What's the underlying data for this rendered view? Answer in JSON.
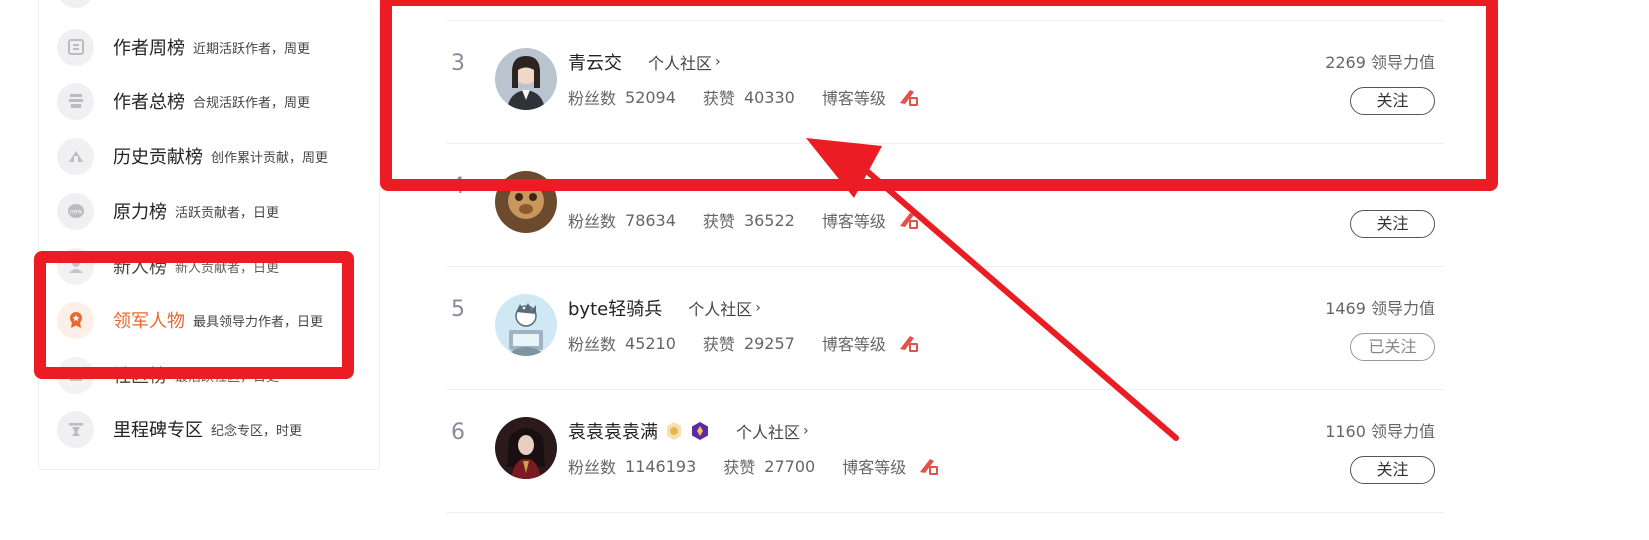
{
  "sidebar": {
    "items": [
      {
        "title": "",
        "desc": "",
        "icon": "badge-icon"
      },
      {
        "title": "作者周榜",
        "desc": "近期活跃作者，周更",
        "icon": "weekly-icon"
      },
      {
        "title": "作者总榜",
        "desc": "合规活跃作者，周更",
        "icon": "total-icon"
      },
      {
        "title": "历史贡献榜",
        "desc": "创作累计贡献，周更",
        "icon": "history-icon"
      },
      {
        "title": "原力榜",
        "desc": "活跃贡献者，日更",
        "icon": "force-icon"
      },
      {
        "title": "新人榜",
        "desc": "新人贡献者，日更",
        "icon": "newcomer-icon"
      },
      {
        "title": "领军人物",
        "desc": "最具领导力作者，日更",
        "icon": "leader-icon",
        "active": true
      },
      {
        "title": "社区榜",
        "desc": "最活跃社区，日更",
        "icon": "community-icon"
      },
      {
        "title": "里程碑专区",
        "desc": "纪念专区，时更",
        "icon": "milestone-icon"
      }
    ]
  },
  "list": {
    "rows": [
      {
        "rank": "3",
        "name": "青云交",
        "community": "个人社区",
        "fans_label": "粉丝数",
        "fans": "52094",
        "likes_label": "获赞",
        "likes": "40330",
        "level_label": "博客等级",
        "lead": "2269 领导力值",
        "follow": "关注",
        "followed": false
      },
      {
        "rank": "4",
        "name": "",
        "community": "",
        "fans_label": "粉丝数",
        "fans": "78634",
        "likes_label": "获赞",
        "likes": "36522",
        "level_label": "博客等级",
        "lead": "",
        "follow": "关注",
        "followed": false
      },
      {
        "rank": "5",
        "name": "byte轻骑兵",
        "community": "个人社区",
        "fans_label": "粉丝数",
        "fans": "45210",
        "likes_label": "获赞",
        "likes": "29257",
        "level_label": "博客等级",
        "lead": "1469 领导力值",
        "follow": "已关注",
        "followed": true
      },
      {
        "rank": "6",
        "name": "袁袁袁袁满",
        "community": "个人社区",
        "fans_label": "粉丝数",
        "fans": "1146193",
        "likes_label": "获赞",
        "likes": "27700",
        "level_label": "博客等级",
        "lead": "1160 领导力值",
        "follow": "关注",
        "followed": false
      }
    ]
  },
  "colors": {
    "accent": "#e8682d",
    "annotation_red": "#ec1c24",
    "level_icon": "#e0524a"
  }
}
